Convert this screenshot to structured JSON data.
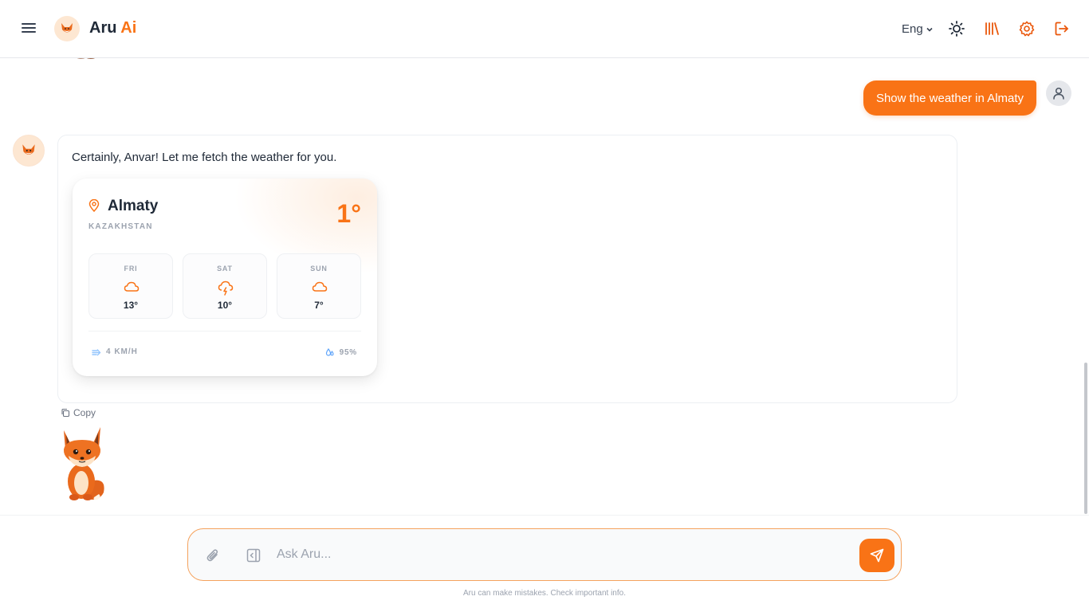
{
  "header": {
    "brand_name": "Aru",
    "brand_accent": "Ai",
    "language": "Eng",
    "icons": [
      "menu-icon",
      "sun-icon",
      "library-icon",
      "settings-icon",
      "logout-icon"
    ]
  },
  "colors": {
    "accent": "#f97316",
    "text": "#1f2937",
    "muted": "#9ca3af"
  },
  "chat": {
    "user_message": "Show the weather in Almaty",
    "bot_message": "Certainly, Anvar! Let me fetch the weather for you.",
    "copy_label": "Copy"
  },
  "weather": {
    "city": "Almaty",
    "country": "KAZAKHSTAN",
    "temperature": "1°",
    "forecast": [
      {
        "day": "FRI",
        "icon": "cloud-icon",
        "temp": "13°"
      },
      {
        "day": "SAT",
        "icon": "thunderstorm-icon",
        "temp": "10°"
      },
      {
        "day": "SUN",
        "icon": "cloud-icon",
        "temp": "7°"
      }
    ],
    "wind": "4 KM/H",
    "humidity": "95%"
  },
  "composer": {
    "placeholder": "Ask Aru...",
    "disclaimer": "Aru can make mistakes. Check important info."
  }
}
